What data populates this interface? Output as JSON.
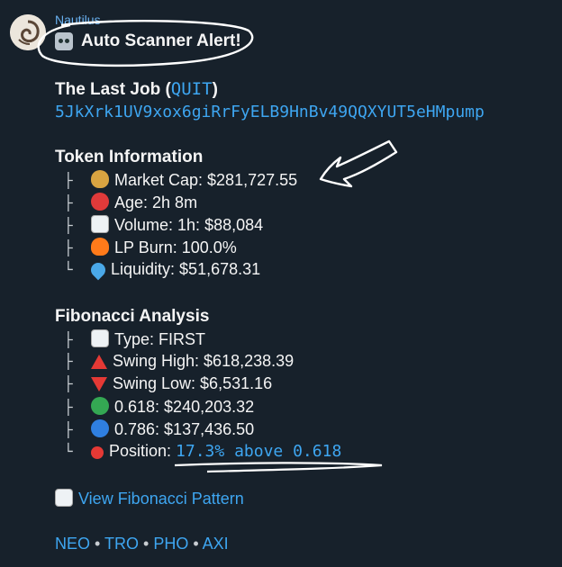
{
  "message": {
    "sender": "Nautilus",
    "title": "Auto Scanner Alert!",
    "job_label": "The Last Job (",
    "job_symbol": "QUIT",
    "job_close": ")",
    "contract": "5JkXrk1UV9xox6giRrFyELB9HnBv49QQXYUT5eHMpump"
  },
  "token_info": {
    "heading": "Token Information",
    "items": [
      {
        "tree": "├",
        "icon": "money-bag-icon",
        "text": "Market Cap: $281,727.55"
      },
      {
        "tree": "├",
        "icon": "alarm-clock-icon",
        "text": "Age: 2h 8m"
      },
      {
        "tree": "├",
        "icon": "bar-chart-icon",
        "text": "Volume: 1h: $88,084"
      },
      {
        "tree": "├",
        "icon": "fire-icon",
        "text": "LP Burn: 100.0%"
      },
      {
        "tree": "└",
        "icon": "droplet-icon",
        "text": "Liquidity: $51,678.31"
      }
    ]
  },
  "fibonacci": {
    "heading": "Fibonacci Analysis",
    "items": [
      {
        "tree": "├",
        "icon": "bar-chart-icon",
        "text": "Type: FIRST"
      },
      {
        "tree": "├",
        "icon": "red-triangle-up-icon",
        "text": "Swing High: $618,238.39"
      },
      {
        "tree": "├",
        "icon": "red-triangle-down-icon",
        "text": "Swing Low: $6,531.16"
      },
      {
        "tree": "├",
        "icon": "green-circle-icon",
        "text": "0.618: $240,203.32"
      },
      {
        "tree": "├",
        "icon": "blue-circle-icon",
        "text": "0.786: $137,436.50"
      },
      {
        "tree": "└",
        "icon": "pin-icon",
        "text": "Position: ",
        "code": "17.3% above 0.618"
      }
    ]
  },
  "pattern_link": "View Fibonacci Pattern",
  "footer_links": [
    "NEO",
    "TRO",
    "PHO",
    "AXI"
  ],
  "footer_sep": " • "
}
